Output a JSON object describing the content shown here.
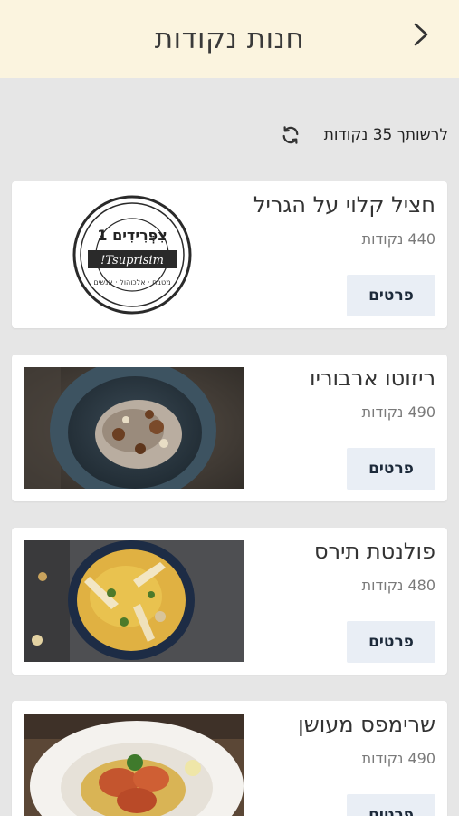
{
  "header": {
    "title": "חנות נקודות",
    "back_icon": "chevron-right-icon"
  },
  "balance": {
    "text": "לרשותך 35 נקודות",
    "refresh_icon": "refresh-icon"
  },
  "items": [
    {
      "name": "חציל קלוי על הגריל",
      "points": "440 נקודות",
      "details_label": "פרטים",
      "image": "restaurant-logo",
      "logo_text_top": "צִפְּרִידִים 1",
      "logo_script": "Tsuprisim!",
      "logo_text_bottom": "מטבח · אלכוהול · אנשים"
    },
    {
      "name": "ריזוטו ארבוריו",
      "points": "490 נקודות",
      "details_label": "פרטים",
      "image": "risotto-photo"
    },
    {
      "name": "פולנטת תירס",
      "points": "480 נקודות",
      "details_label": "פרטים",
      "image": "polenta-photo"
    },
    {
      "name": "שרימפס מעושן",
      "points": "490 נקודות",
      "details_label": "פרטים",
      "image": "shrimp-photo"
    }
  ],
  "colors": {
    "header_bg": "#fbf4df",
    "page_bg": "#e6e6e6",
    "button_bg": "#e9eef5",
    "button_text": "#1d2a3a"
  }
}
